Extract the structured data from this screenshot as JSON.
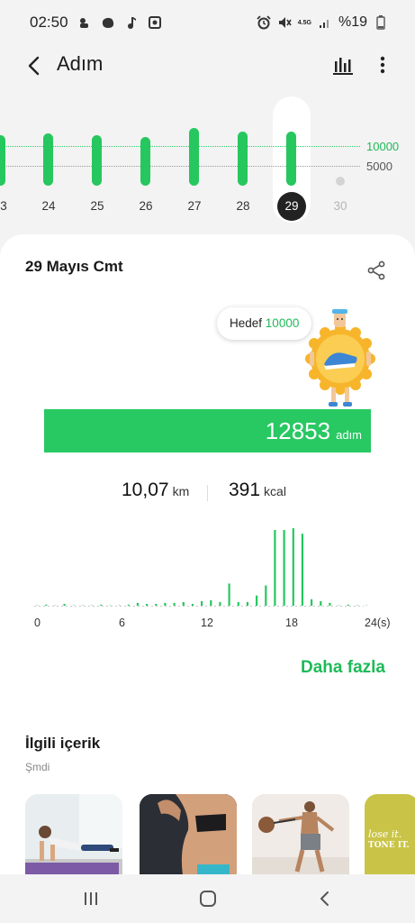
{
  "status": {
    "time": "02:50",
    "network": "4.5G",
    "battery": "%19",
    "left_icons": [
      "thumbs-up-icon",
      "blob-icon",
      "music-note-icon",
      "media-icon"
    ]
  },
  "header": {
    "title": "Adım"
  },
  "weekly": {
    "goal_label": "10000",
    "ref_label": "5000",
    "days": [
      "3",
      "24",
      "25",
      "26",
      "27",
      "28",
      "29",
      "30"
    ],
    "selected_day": "29",
    "steps": [
      12000,
      12500,
      12000,
      11700,
      13800,
      13000,
      12853,
      0
    ]
  },
  "summary": {
    "date": "29 Mayıs Cmt",
    "goal_prefix": "Hedef",
    "goal_value": "10000",
    "steps": "12853",
    "steps_unit": "adım",
    "distance": "10,07",
    "distance_unit": "km",
    "calories": "391",
    "calories_unit": "kcal"
  },
  "hourly_chart": {
    "type": "bar",
    "x_ticks": [
      "0",
      "6",
      "12",
      "18",
      "24(s)"
    ],
    "values": [
      0,
      1,
      0,
      2,
      0,
      0,
      0,
      1,
      0,
      0,
      1,
      3,
      2,
      2,
      3,
      3,
      4,
      2,
      5,
      6,
      4,
      24,
      4,
      4,
      11,
      22,
      82,
      82,
      84,
      78,
      7,
      5,
      3,
      0,
      1,
      0,
      0
    ],
    "bar_colors": {
      "active": "#27c75f",
      "dim": "#bfe9ce"
    }
  },
  "more_link": "Daha fazla",
  "related": {
    "title": "İlgili içerik",
    "subtitle": "Şmdi",
    "card4_text": [
      "lose it.",
      "TONE IT."
    ]
  },
  "colors": {
    "accent": "#27c75f",
    "goal_text": "#1fba58"
  }
}
